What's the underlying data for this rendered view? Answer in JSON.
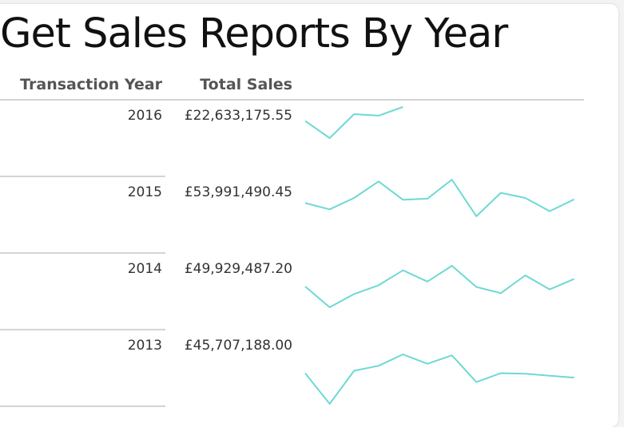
{
  "report": {
    "title": "Get Sales Reports By Year",
    "columns": {
      "year": "Transaction Year",
      "total_sales": "Total Sales"
    },
    "sparkline_color": "#6ed9d3",
    "rows": [
      {
        "year": "2016",
        "total_sales": "£22,633,175.55",
        "trend": [
          0.55,
          0.0,
          0.77,
          0.72,
          1.0
        ]
      },
      {
        "year": "2015",
        "total_sales": "£53,991,490.45",
        "trend": [
          0.36,
          0.19,
          0.5,
          0.95,
          0.45,
          0.48,
          1.0,
          0.0,
          0.64,
          0.5,
          0.14,
          0.46
        ]
      },
      {
        "year": "2014",
        "total_sales": "£49,929,487.20",
        "trend": [
          0.5,
          0.0,
          0.32,
          0.53,
          0.89,
          0.62,
          1.0,
          0.49,
          0.34,
          0.77,
          0.43,
          0.68
        ]
      },
      {
        "year": "2013",
        "total_sales": "£45,707,188.00",
        "trend": [
          0.62,
          0.0,
          0.67,
          0.77,
          1.0,
          0.81,
          0.98,
          0.44,
          0.62,
          0.61,
          0.57,
          0.53
        ]
      }
    ]
  }
}
